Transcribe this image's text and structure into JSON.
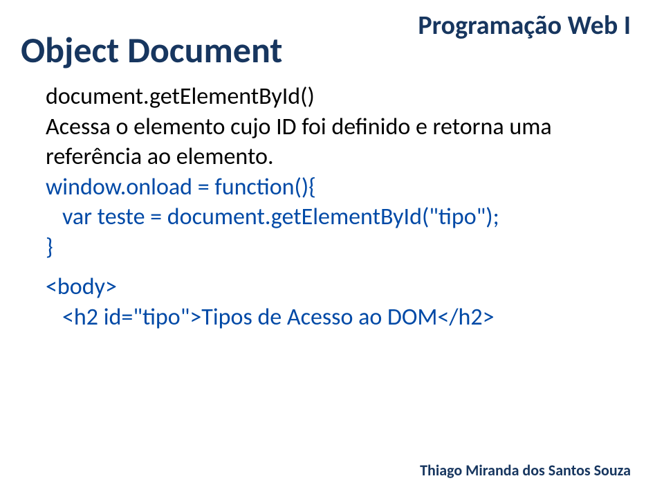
{
  "header": {
    "course": "Programação Web I"
  },
  "title": "Object Document",
  "body": {
    "method": "document.getElementById()",
    "desc_l1": "Acessa o elemento cujo ID foi definido e retorna uma",
    "desc_l2": "referência ao elemento.",
    "code_l1": "window.onload = function(){",
    "code_l2_a": "var teste = document.getElementById(",
    "code_l2_b": "\"",
    "code_l2_c": "tipo",
    "code_l2_d": "\"",
    "code_l2_e": ");",
    "code_l3": "}",
    "html_l1": "<body>",
    "html_l2_a": "<h2 id=",
    "html_l2_b": "\"",
    "html_l2_c": "tipo",
    "html_l2_d": "\"",
    "html_l2_e": ">Tipos de Acesso ao DOM</h2>"
  },
  "footer": {
    "author": "Thiago Miranda dos Santos Souza"
  }
}
